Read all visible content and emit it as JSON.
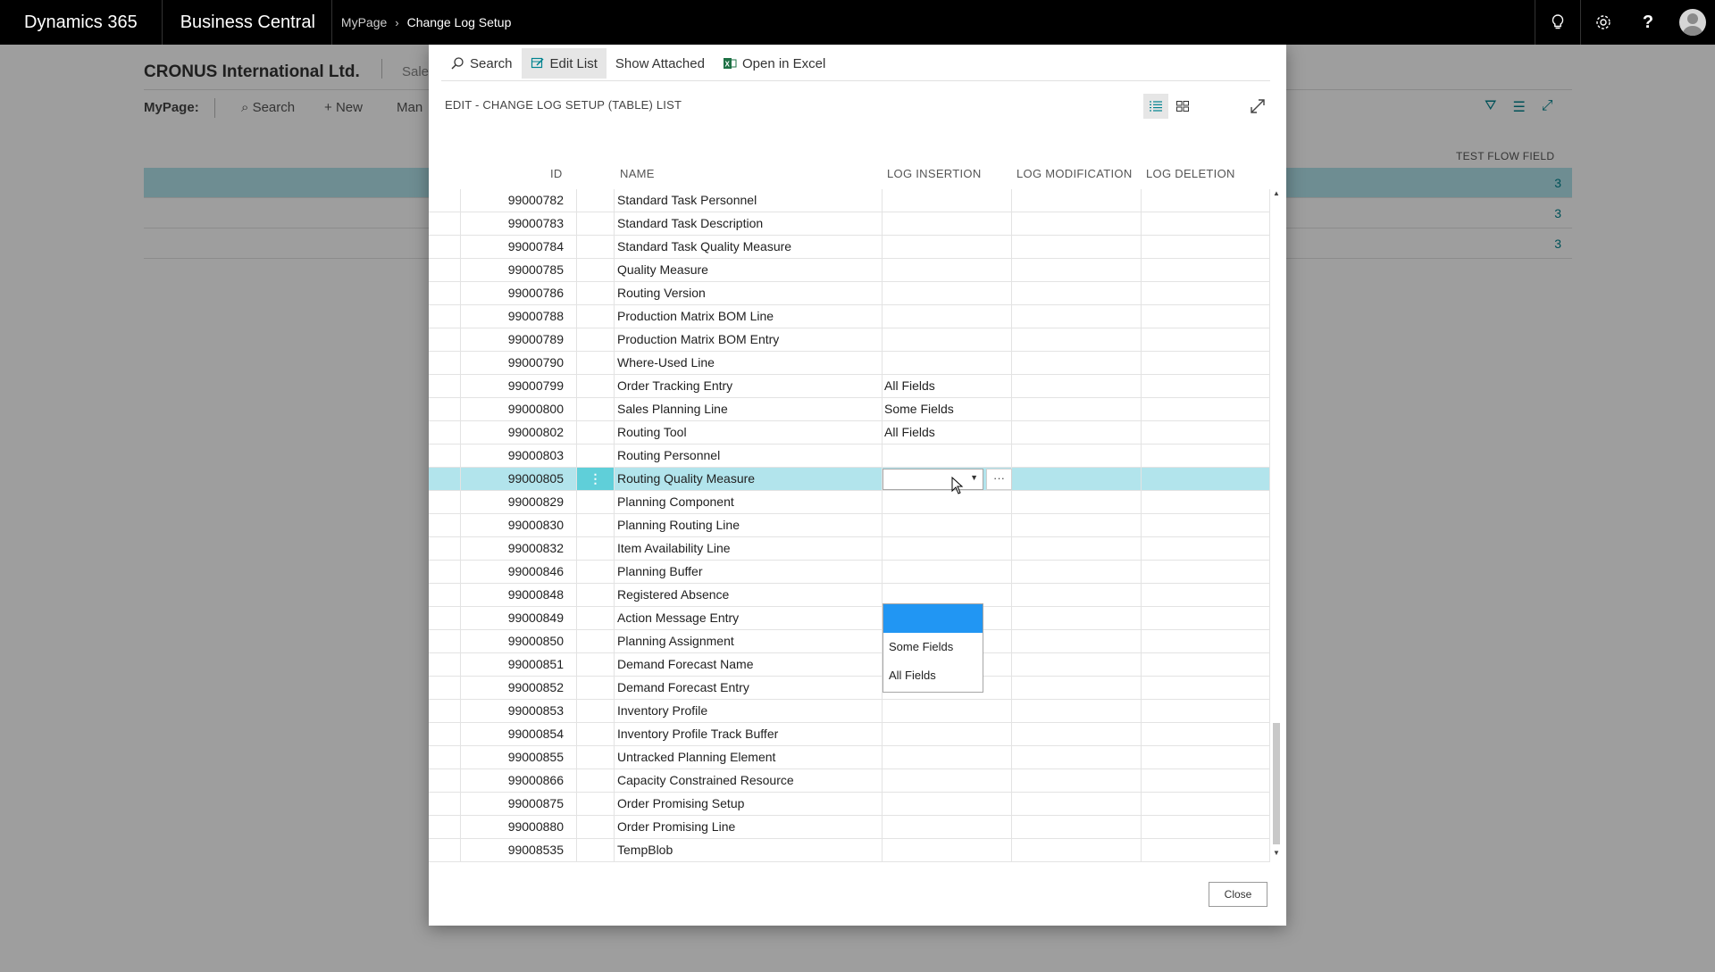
{
  "appbar": {
    "brand": "Dynamics 365",
    "product": "Business Central",
    "breadcrumb": [
      "MyPage",
      "Change Log Setup"
    ]
  },
  "background": {
    "company": "CRONUS International Ltd.",
    "sales_tab": "Sale",
    "mypage_label": "MyPage:",
    "search_label": "Search",
    "new_label": "New",
    "manage_label": "Man",
    "flow_header": "TEST FLOW FIELD",
    "flow_values": [
      "3",
      "3",
      "3"
    ]
  },
  "dialog": {
    "actions": {
      "search": "Search",
      "edit_list": "Edit List",
      "show_attached": "Show Attached",
      "open_in_excel": "Open in Excel"
    },
    "title": "EDIT - CHANGE LOG SETUP (TABLE) LIST",
    "columns": {
      "id": "ID",
      "name": "NAME",
      "log_insertion": "LOG INSERTION",
      "log_modification": "LOG MODIFICATION",
      "log_deletion": "LOG DELETION"
    },
    "rows": [
      {
        "id": "99000782",
        "name": "Standard Task Personnel",
        "ins": "",
        "mod": "",
        "del": ""
      },
      {
        "id": "99000783",
        "name": "Standard Task Description",
        "ins": "",
        "mod": "",
        "del": ""
      },
      {
        "id": "99000784",
        "name": "Standard Task Quality Measure",
        "ins": "",
        "mod": "",
        "del": ""
      },
      {
        "id": "99000785",
        "name": "Quality Measure",
        "ins": "",
        "mod": "",
        "del": ""
      },
      {
        "id": "99000786",
        "name": "Routing Version",
        "ins": "",
        "mod": "",
        "del": ""
      },
      {
        "id": "99000788",
        "name": "Production Matrix BOM Line",
        "ins": "",
        "mod": "",
        "del": ""
      },
      {
        "id": "99000789",
        "name": "Production Matrix BOM Entry",
        "ins": "",
        "mod": "",
        "del": ""
      },
      {
        "id": "99000790",
        "name": "Where-Used Line",
        "ins": "",
        "mod": "",
        "del": ""
      },
      {
        "id": "99000799",
        "name": "Order Tracking Entry",
        "ins": "All Fields",
        "mod": "",
        "del": ""
      },
      {
        "id": "99000800",
        "name": "Sales Planning Line",
        "ins": "Some Fields",
        "mod": "",
        "del": ""
      },
      {
        "id": "99000802",
        "name": "Routing Tool",
        "ins": "All Fields",
        "mod": "",
        "del": ""
      },
      {
        "id": "99000803",
        "name": "Routing Personnel",
        "ins": "",
        "mod": "",
        "del": ""
      },
      {
        "id": "99000805",
        "name": "Routing Quality Measure",
        "ins": "",
        "mod": "",
        "del": ""
      },
      {
        "id": "99000829",
        "name": "Planning Component",
        "ins": "",
        "mod": "",
        "del": ""
      },
      {
        "id": "99000830",
        "name": "Planning Routing Line",
        "ins": "",
        "mod": "",
        "del": ""
      },
      {
        "id": "99000832",
        "name": "Item Availability Line",
        "ins": "",
        "mod": "",
        "del": ""
      },
      {
        "id": "99000846",
        "name": "Planning Buffer",
        "ins": "",
        "mod": "",
        "del": ""
      },
      {
        "id": "99000848",
        "name": "Registered Absence",
        "ins": "",
        "mod": "",
        "del": ""
      },
      {
        "id": "99000849",
        "name": "Action Message Entry",
        "ins": "",
        "mod": "",
        "del": ""
      },
      {
        "id": "99000850",
        "name": "Planning Assignment",
        "ins": "",
        "mod": "",
        "del": ""
      },
      {
        "id": "99000851",
        "name": "Demand Forecast Name",
        "ins": "",
        "mod": "",
        "del": ""
      },
      {
        "id": "99000852",
        "name": "Demand Forecast Entry",
        "ins": "",
        "mod": "",
        "del": ""
      },
      {
        "id": "99000853",
        "name": "Inventory Profile",
        "ins": "",
        "mod": "",
        "del": ""
      },
      {
        "id": "99000854",
        "name": "Inventory Profile Track Buffer",
        "ins": "",
        "mod": "",
        "del": ""
      },
      {
        "id": "99000855",
        "name": "Untracked Planning Element",
        "ins": "",
        "mod": "",
        "del": ""
      },
      {
        "id": "99000866",
        "name": "Capacity Constrained Resource",
        "ins": "",
        "mod": "",
        "del": ""
      },
      {
        "id": "99000875",
        "name": "Order Promising Setup",
        "ins": "",
        "mod": "",
        "del": ""
      },
      {
        "id": "99000880",
        "name": "Order Promising Line",
        "ins": "",
        "mod": "",
        "del": ""
      },
      {
        "id": "99008535",
        "name": "TempBlob",
        "ins": "",
        "mod": "",
        "del": ""
      }
    ],
    "selected_row_index": 12,
    "row_menu_glyph": "⋮",
    "ellipsis_label": "···",
    "dropdown_options": [
      "",
      "Some Fields",
      "All Fields"
    ],
    "close_label": "Close"
  },
  "colors": {
    "accent": "#00838f",
    "selected_row": "#b2e4ec",
    "highlight_option": "#2196f3",
    "appbar": "#000000"
  }
}
